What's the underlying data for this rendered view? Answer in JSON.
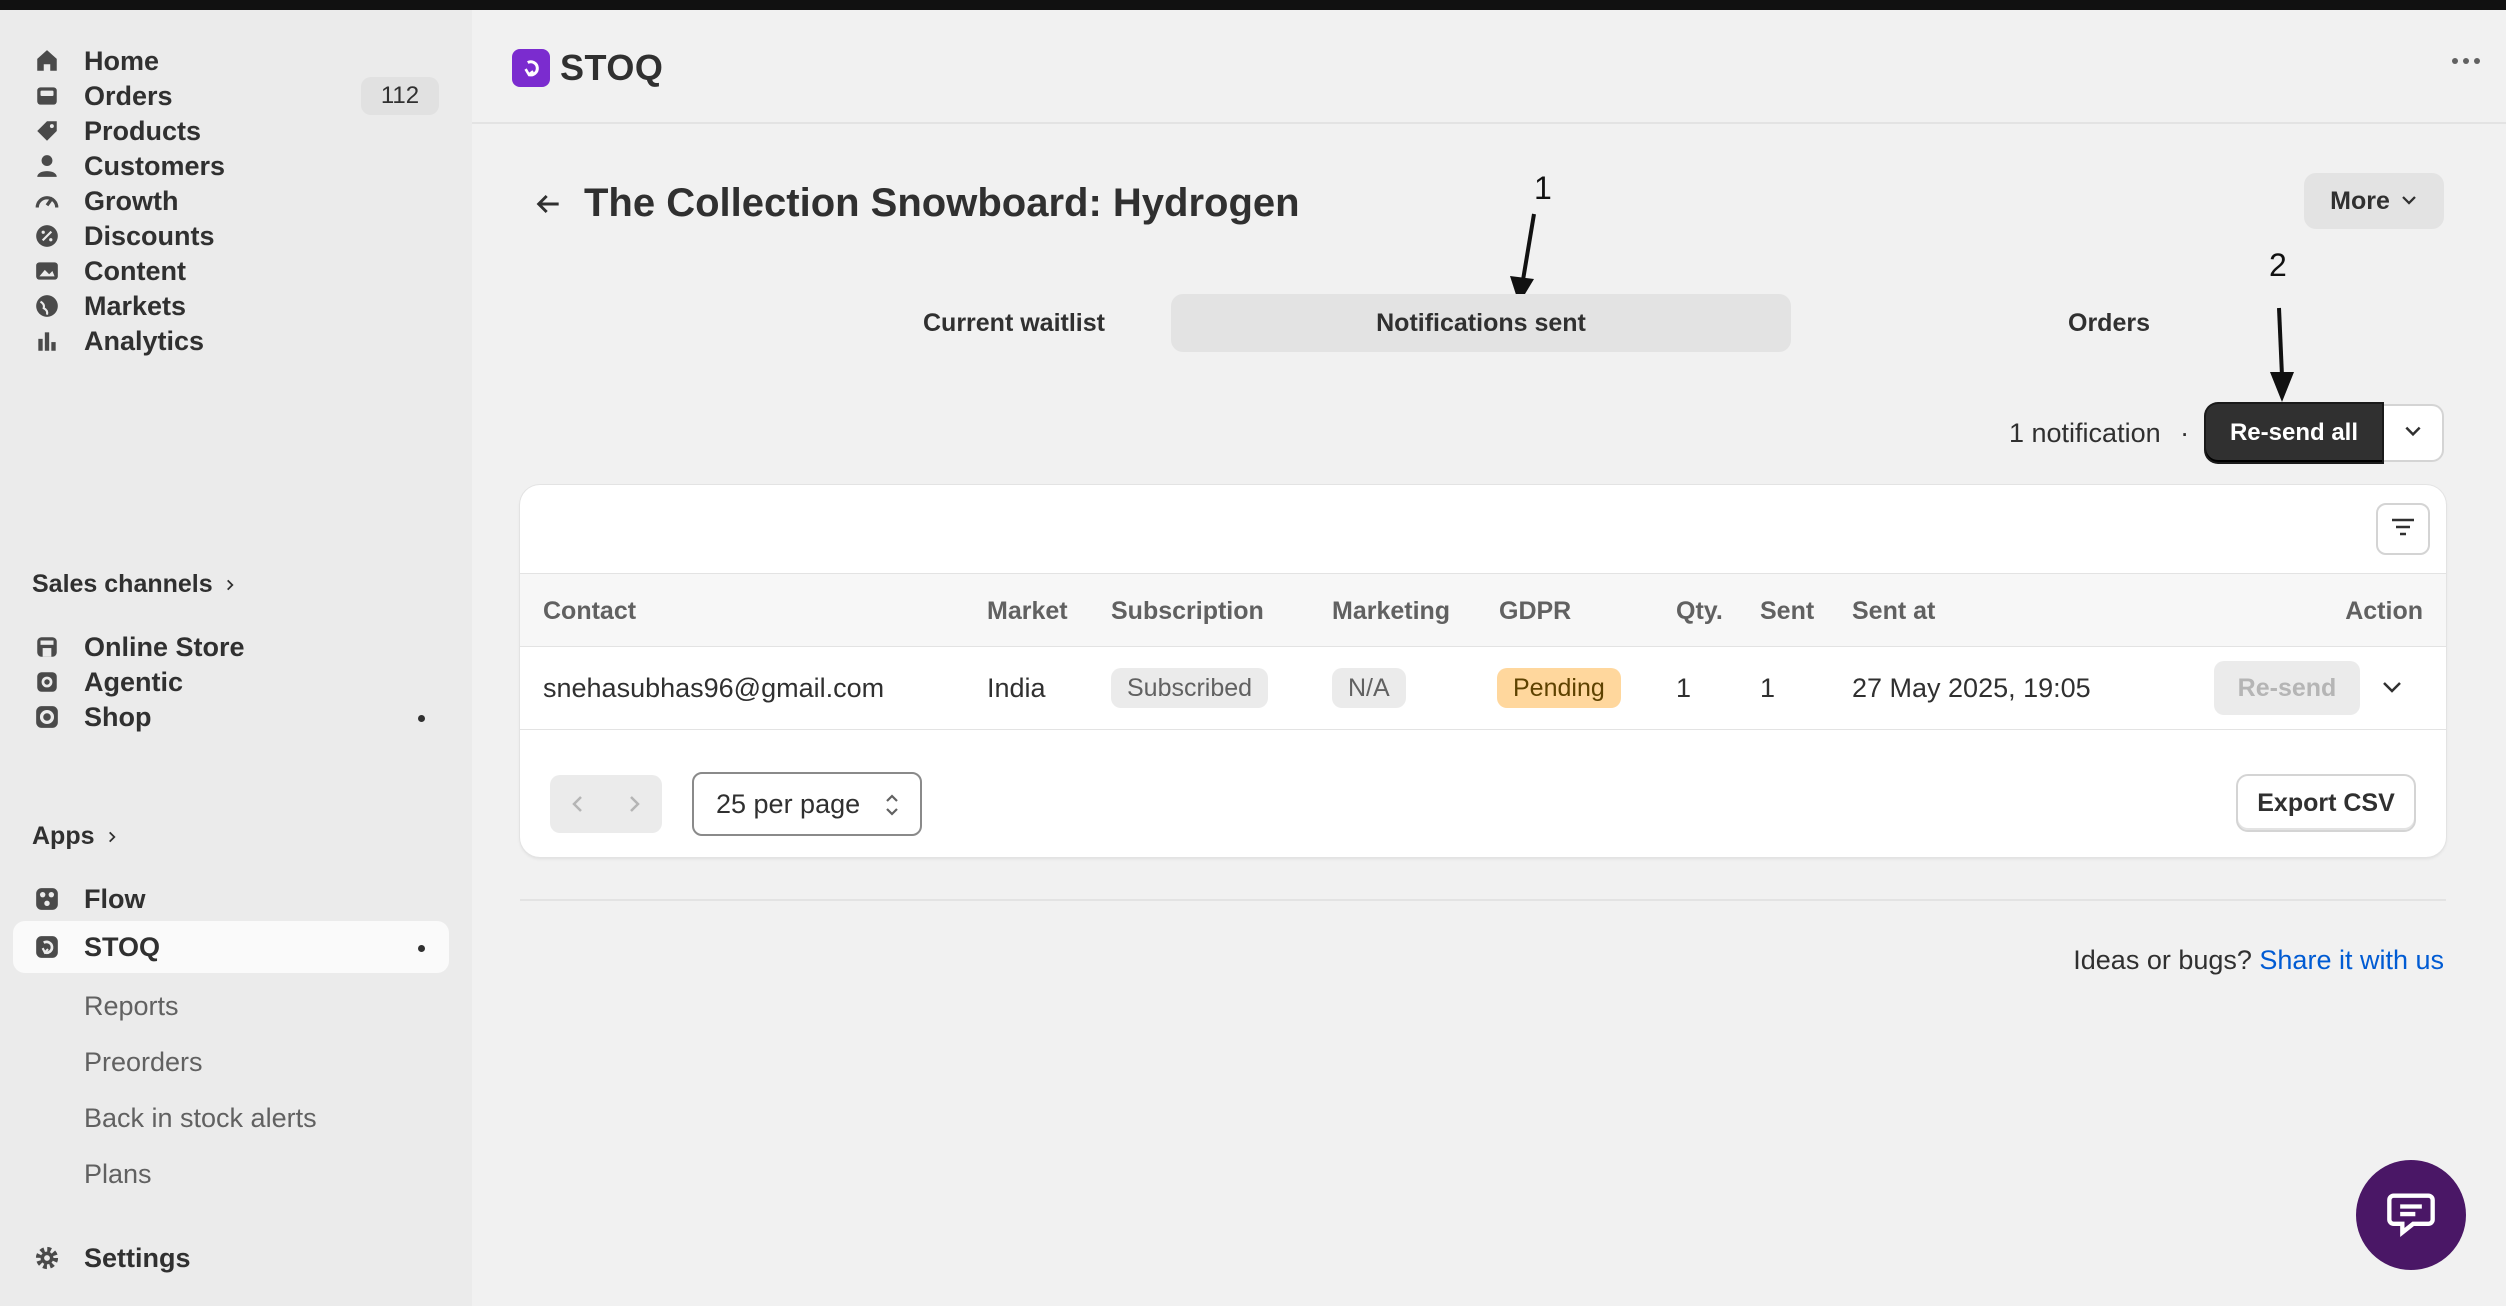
{
  "sidebar": {
    "items": [
      {
        "label": "Home",
        "icon": "home-icon"
      },
      {
        "label": "Orders",
        "icon": "orders-icon",
        "count": "112"
      },
      {
        "label": "Products",
        "icon": "tag-icon"
      },
      {
        "label": "Customers",
        "icon": "person-icon"
      },
      {
        "label": "Growth",
        "icon": "gauge-icon"
      },
      {
        "label": "Discounts",
        "icon": "discount-icon"
      },
      {
        "label": "Content",
        "icon": "image-icon"
      },
      {
        "label": "Markets",
        "icon": "globe-icon"
      },
      {
        "label": "Analytics",
        "icon": "bar-chart-icon"
      }
    ],
    "sales_channels_label": "Sales channels",
    "channels": [
      {
        "label": "Online Store",
        "icon": "store-icon"
      },
      {
        "label": "Agentic",
        "icon": "robot-icon"
      },
      {
        "label": "Shop",
        "icon": "shop-icon"
      }
    ],
    "apps_label": "Apps",
    "apps": [
      {
        "label": "Flow",
        "icon": "flow-icon"
      },
      {
        "label": "STOQ",
        "icon": "stoq-icon"
      }
    ],
    "stoq_sub": [
      "Reports",
      "Preorders",
      "Back in stock alerts",
      "Plans"
    ],
    "settings_label": "Settings"
  },
  "header": {
    "brand": "STOQ",
    "brand_color": "#7b2ccf"
  },
  "page": {
    "title": "The Collection Snowboard: Hydrogen",
    "more_label": "More",
    "annotation_1": "1",
    "annotation_2": "2",
    "tabs": [
      "Current waitlist",
      "Notifications sent",
      "Orders"
    ],
    "active_tab": "Notifications sent",
    "notification_count": "1 notification",
    "separator": "·",
    "resend_all_label": "Re-send all"
  },
  "table": {
    "columns": [
      "Contact",
      "Market",
      "Subscription",
      "Marketing",
      "GDPR",
      "Qty.",
      "Sent",
      "Sent at",
      "Action"
    ],
    "rows": [
      {
        "contact": "snehasubhas96@gmail.com",
        "market": "India",
        "subscription": "Subscribed",
        "marketing": "N/A",
        "gdpr": "Pending",
        "qty": "1",
        "sent": "1",
        "sent_at": "27 May 2025, 19:05",
        "action": "Re-send"
      }
    ],
    "per_page": "25 per page",
    "export_label": "Export CSV"
  },
  "footer": {
    "prompt": "Ideas or bugs?",
    "link": "Share it with us"
  }
}
